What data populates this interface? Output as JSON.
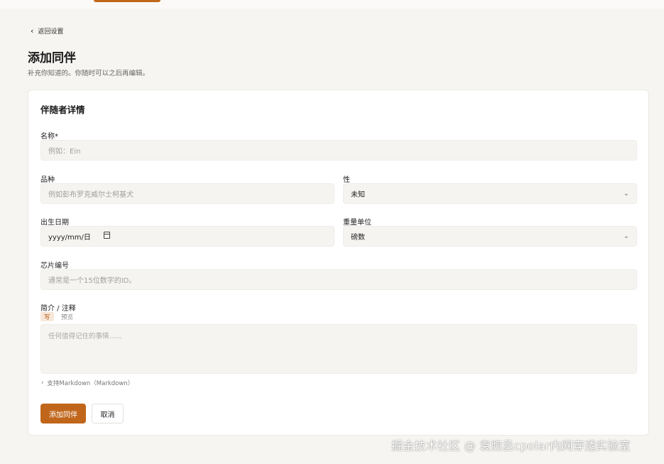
{
  "nav": {
    "back_label": "返回设置"
  },
  "header": {
    "title": "添加同伴",
    "subtitle": "补充你知道的。你随时可以之后再编辑。"
  },
  "card": {
    "title": "伴随者详情",
    "name": {
      "label": "名称*",
      "placeholder": "例如：Ein"
    },
    "breed": {
      "label": "品种",
      "placeholder": "例如彭布罗克威尔士柯基犬"
    },
    "sex": {
      "label": "性",
      "value": "未知"
    },
    "birthdate": {
      "label": "出生日期",
      "placeholder": "yyyy/mm/日"
    },
    "weight_unit": {
      "label": "重量单位",
      "value": "磅数"
    },
    "chip": {
      "label": "芯片编号",
      "placeholder": "通常是一个15位数字的ID。"
    },
    "notes": {
      "label": "简介 / 注释",
      "tab_write": "写",
      "tab_preview": "预览",
      "placeholder": "任何值得记住的事情......",
      "markdown_hint": "支持Markdown（Markdown）"
    },
    "submit_label": "添加同伴",
    "cancel_label": "取消"
  },
  "watermark": "掘金技术社区 @ 袁煦丞cpolar内网穿透实验室",
  "colors": {
    "accent": "#c0661b",
    "background": "#f6f5f2",
    "field": "#f5f4f1"
  },
  "icons": {
    "back": "chevron-left-icon",
    "select": "chevron-down-icon",
    "calendar": "calendar-icon",
    "expand": "chevron-right-icon"
  }
}
